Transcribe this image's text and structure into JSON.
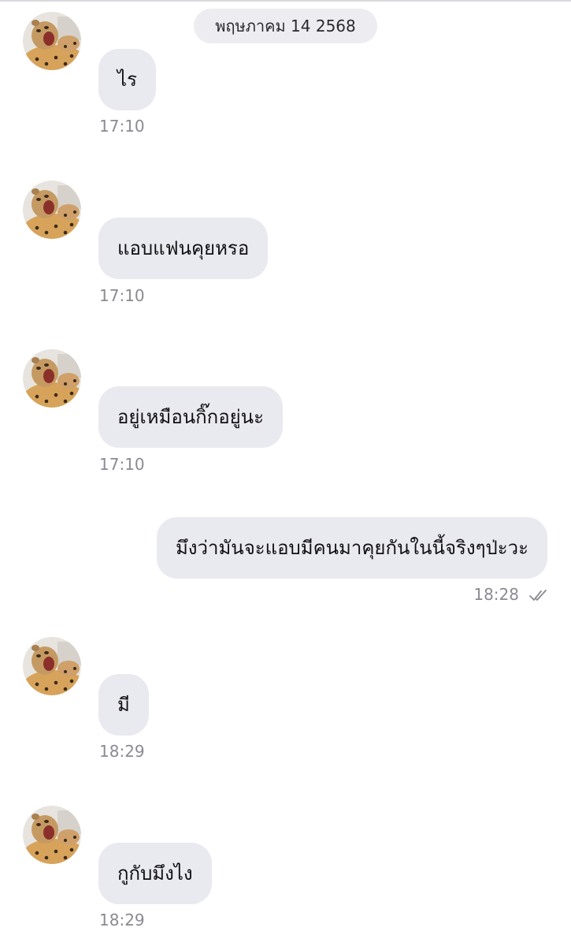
{
  "date_separator": "พฤษภาคม 14 2568",
  "messages": [
    {
      "sender": "contact",
      "text": "ไร",
      "time": "17:10"
    },
    {
      "sender": "contact",
      "text": "แอบแฟนคุยหรอ",
      "time": "17:10"
    },
    {
      "sender": "contact",
      "text": "อยู่เหมือนกิ๊กอยู่นะ",
      "time": "17:10"
    },
    {
      "sender": "me",
      "text": "มึงว่ามันจะแอบมีคนมาคุยกันในนี้จริงๆป่ะวะ",
      "time": "18:28",
      "status_icon": "double-check-icon"
    },
    {
      "sender": "contact",
      "text": "มี",
      "time": "18:29"
    },
    {
      "sender": "contact",
      "text": "กูกับมึงไง",
      "time": "18:29"
    }
  ],
  "colors": {
    "incoming_bubble": "#e9e9f0",
    "outgoing_bubble": "#e9e9f0",
    "timestamp": "#8a8a92",
    "date_pill": "#ececf1"
  },
  "avatar_icon": "cheetah-avatar-icon"
}
